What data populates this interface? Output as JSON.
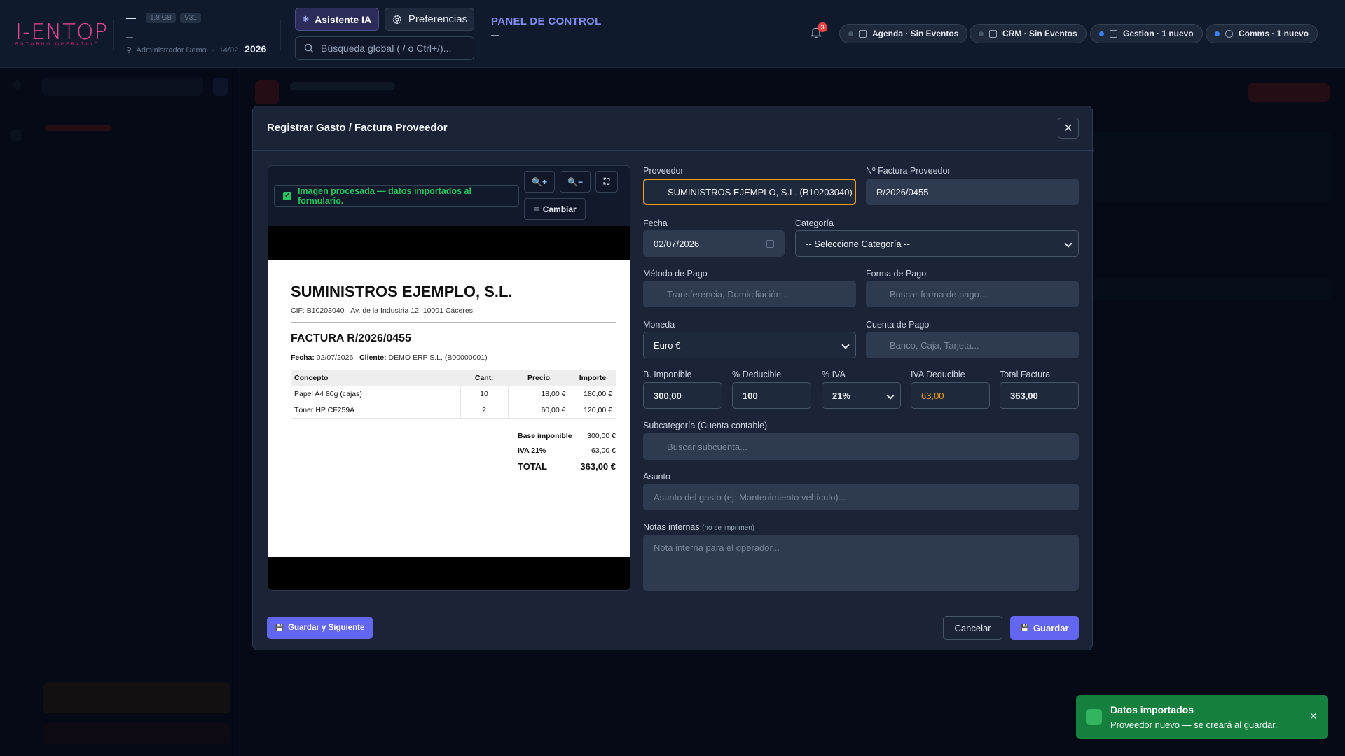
{
  "topbar": {
    "logo_text": "I-ENTOP",
    "logo_sub": "ENTORNO OPERATIVO",
    "memory_badge": "1.8 GB",
    "version_badge": "V31",
    "user": "Administrador Demo",
    "date_short": "14/02",
    "year": "2026",
    "assistant_label": "Asistente IA",
    "preferences_label": "Preferencias",
    "search_placeholder": "Búsqueda global ( / o Ctrl+/)...",
    "panel_title": "PANEL DE CONTROL",
    "notifications_count": "3",
    "chips": [
      {
        "label": "Agenda · Sin Eventos"
      },
      {
        "label": "CRM · Sin Eventos"
      },
      {
        "label": "Gestion · 1 nuevo"
      },
      {
        "label": "Comms · 1 nuevo"
      }
    ]
  },
  "modal": {
    "title": "Registrar Gasto / Factura Proveedor",
    "close_label": "✕",
    "preview": {
      "processed_text": "Imagen procesada — datos importados al formulario.",
      "zoom_in": "🔍+",
      "zoom_out": "🔍−",
      "fullscreen": "⛶",
      "change_label": "Cambiar"
    },
    "invoice": {
      "company": "SUMINISTROS EJEMPLO, S.L.",
      "cif_line": "CIF: B10203040 · Av. de la Industria 12, 10001 Cáceres",
      "title": "FACTURA R/2026/0455",
      "date_label": "Fecha:",
      "date_value": "02/07/2026",
      "client_label": "Cliente:",
      "client_value": "DEMO ERP S.L. (B00000001)",
      "columns": [
        "Concepto",
        "Cant.",
        "Precio",
        "Importe"
      ],
      "rows": [
        {
          "concept": "Papel A4 80g (cajas)",
          "qty": "10",
          "price": "18,00 €",
          "amount": "180,00 €"
        },
        {
          "concept": "Tóner HP CF259A",
          "qty": "2",
          "price": "60,00 €",
          "amount": "120,00 €"
        }
      ],
      "base_label": "Base imponible",
      "base_value": "300,00 €",
      "iva_label": "IVA 21%",
      "iva_value": "63,00 €",
      "total_label": "TOTAL",
      "total_value": "363,00 €"
    },
    "form": {
      "proveedor_label": "Proveedor",
      "proveedor_value": "SUMINISTROS EJEMPLO, S.L.  (B10203040)",
      "nfactura_label": "Nº Factura Proveedor",
      "nfactura_value": "R/2026/0455",
      "fecha_label": "Fecha",
      "fecha_value": "02/07/2026",
      "categoria_label": "Categoría",
      "categoria_value": "-- Seleccione Categoría --",
      "metodo_label": "Método de Pago",
      "metodo_placeholder": "Transferencia, Domiciliación...",
      "forma_label": "Forma de Pago",
      "forma_placeholder": "Buscar forma de pago...",
      "moneda_label": "Moneda",
      "moneda_value": "Euro €",
      "cuenta_label": "Cuenta de Pago",
      "cuenta_placeholder": "Banco, Caja, Tarjeta...",
      "base_label": "B. Imponible",
      "base_value": "300,00",
      "deducible_label": "% Deducible",
      "deducible_value": "100",
      "iva_label": "% IVA",
      "iva_value": "21%",
      "iva_ded_label": "IVA Deducible",
      "iva_ded_value": "63,00",
      "total_label": "Total Factura",
      "total_value": "363,00",
      "subcat_label": "Subcategoría (Cuenta contable)",
      "subcat_placeholder": "Buscar subcuenta...",
      "asunto_label": "Asunto",
      "asunto_placeholder": "Asunto del gasto (ej: Mantenimiento vehículo)...",
      "notas_label": "Notas internas",
      "notas_hint": "(no se imprimen)",
      "notas_placeholder": "Nota interna para el operador..."
    },
    "footer": {
      "save_next": "Guardar y Siguiente",
      "cancel": "Cancelar",
      "save": "Guardar"
    }
  },
  "toast": {
    "title": "Datos importados",
    "message": "Proveedor nuevo — se creará al guardar.",
    "close": "✕"
  },
  "colors": {
    "accent": "#6366f1",
    "brand": "#ec4899",
    "success": "#15803d",
    "highlight": "#f59e0b"
  }
}
